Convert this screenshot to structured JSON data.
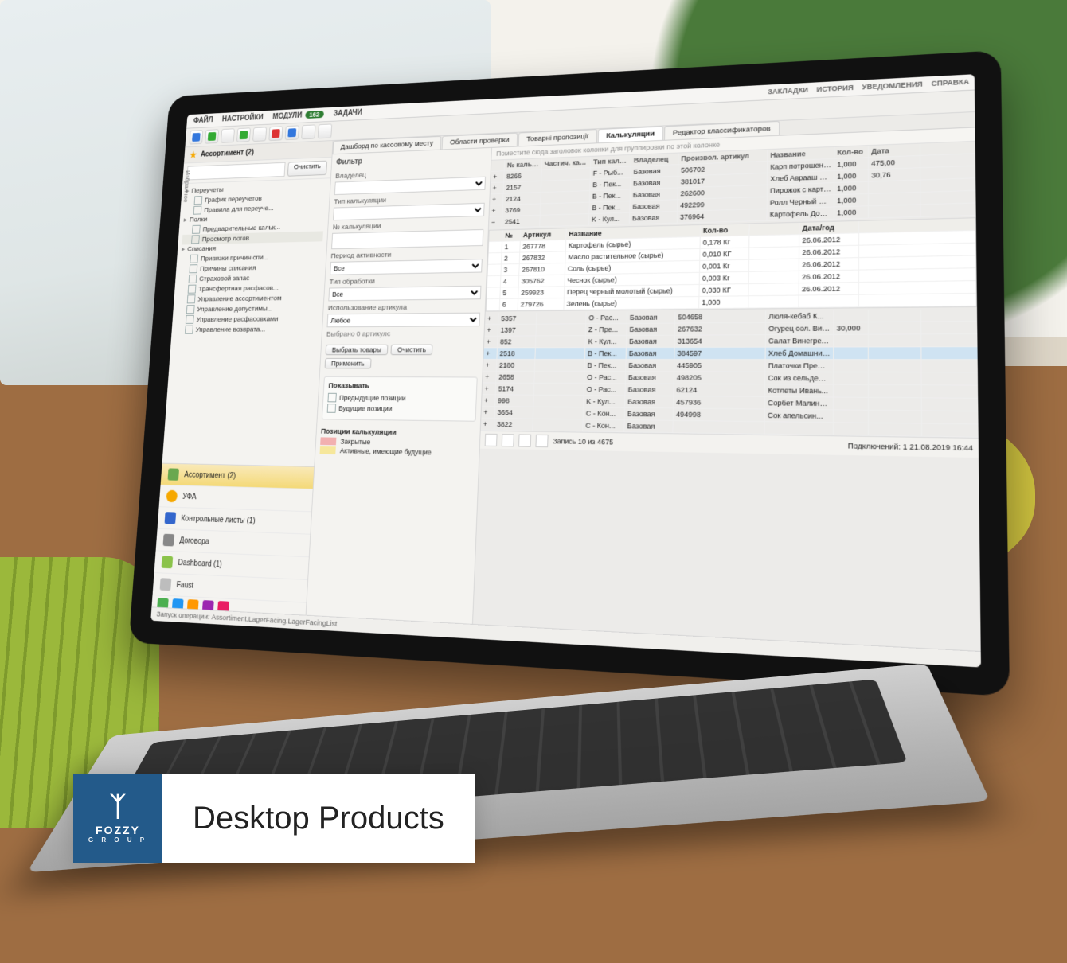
{
  "caption": {
    "brand": "FOZZY",
    "brand_sub": "G R O U P",
    "title": "Desktop Products"
  },
  "menu": {
    "items": [
      "ФАЙЛ",
      "НАСТРОЙКИ",
      "МОДУЛИ",
      "ЗАДАЧИ"
    ],
    "badge": "162",
    "right": [
      "ЗАКЛАДКИ",
      "ИСТОРИЯ",
      "УВЕДОМЛЕНИЯ",
      "СПРАВКА"
    ]
  },
  "sidebar": {
    "header": "Ассортимент (2)",
    "side_tab": "Избранное",
    "clear": "Очистить",
    "tree": [
      {
        "label": "Переучеты",
        "kind": "folder"
      },
      {
        "label": "График переучетов",
        "kind": "item"
      },
      {
        "label": "Правила для переуче...",
        "kind": "item"
      },
      {
        "label": "Полки",
        "kind": "folder"
      },
      {
        "label": "Предварительные кальк...",
        "kind": "item"
      },
      {
        "label": "Просмотр логов",
        "kind": "item",
        "sel": true
      },
      {
        "label": "Списания",
        "kind": "folder"
      },
      {
        "label": "Привязки причин спи...",
        "kind": "item"
      },
      {
        "label": "Причины списания",
        "kind": "item"
      },
      {
        "label": "Страховой запас",
        "kind": "item"
      },
      {
        "label": "Трансфертная расфасов...",
        "kind": "item"
      },
      {
        "label": "Управление ассортиментом",
        "kind": "item"
      },
      {
        "label": "Управление допустимы...",
        "kind": "item"
      },
      {
        "label": "Управление расфасовками",
        "kind": "item"
      },
      {
        "label": "Управление возврата...",
        "kind": "item"
      }
    ],
    "nav": [
      {
        "label": "Ассортимент (2)",
        "ic": "ic-ass",
        "active": true
      },
      {
        "label": "УФА",
        "ic": "ic-ufa"
      },
      {
        "label": "Контрольные листы (1)",
        "ic": "ic-kl"
      },
      {
        "label": "Договора",
        "ic": "ic-dog"
      },
      {
        "label": "Dashboard (1)",
        "ic": "ic-dash"
      },
      {
        "label": "Faust",
        "ic": "ic-faust"
      }
    ]
  },
  "tabs": [
    "Дашборд по кассовому месту",
    "Области проверки",
    "Товарні пропозиції",
    "Калькуляции",
    "Редактор классификаторов"
  ],
  "active_tab": 3,
  "filter": {
    "title": "Фильтр",
    "fields": {
      "owner": "Владелец",
      "type": "Тип калькуляции",
      "num": "№ калькуляции",
      "period": "Период активности",
      "proc": "Тип обработки",
      "use_art": "Использование артикула"
    },
    "period_val": "Все",
    "proc_val": "Все",
    "use_art_val": "Любое",
    "selected_info": "Выбрано 0 артикулс",
    "btn_select": "Выбрать товары",
    "btn_clear": "Очистить",
    "btn_apply": "Применить",
    "show_title": "Показывать",
    "chk_prev": "Предыдущие позиции",
    "chk_future": "Будущие позиции",
    "legend_title": "Позиции калькуляции",
    "legend_closed": "Закрытые",
    "legend_active": "Активные, имеющие будущие"
  },
  "grid": {
    "group_hint": "Поместите сюда заголовок колонки для группировки по этой колонке",
    "cols": [
      "",
      "№ калькул.",
      "Частич. калькул.",
      "Тип калькул.",
      "Владелец",
      "Произвол. артикул",
      "Название",
      "Кол-во",
      "Дата"
    ],
    "rows": [
      {
        "exp": "+",
        "num": "8266",
        "part": "",
        "type": "F - Рыб...",
        "owner": "Базовая",
        "art": "506702",
        "name": "Карп потрошеный ч...",
        "qty": "1,000",
        "date": "475,00"
      },
      {
        "exp": "+",
        "num": "2157",
        "part": "",
        "type": "B - Пек...",
        "owner": "Базовая",
        "art": "381017",
        "name": "Хлеб Аврааш Фітнес",
        "qty": "1,000",
        "date": "30,76"
      },
      {
        "exp": "+",
        "num": "2124",
        "part": "",
        "type": "B - Пек...",
        "owner": "Базовая",
        "art": "262600",
        "name": "Пирожок с картошкой...",
        "qty": "1,000",
        "date": ""
      },
      {
        "exp": "+",
        "num": "3769",
        "part": "",
        "type": "B - Пек...",
        "owner": "Базовая",
        "art": "492299",
        "name": "Ролл Черный Дракон",
        "qty": "1,000",
        "date": ""
      },
      {
        "exp": "−",
        "num": "2541",
        "part": "",
        "type": "K - Кул...",
        "owner": "Базовая",
        "art": "376964",
        "name": "Картофель Дольки фри",
        "qty": "1,000",
        "date": ""
      }
    ],
    "sub_cols": [
      "",
      "№",
      "Артикул",
      "Название",
      "Кол-во",
      "",
      "Дата/год"
    ],
    "sub_rows": [
      {
        "n": "1",
        "art": "267778",
        "name": "Картофель (сырье)",
        "qty": "0,178 Кг",
        "d": "26.06.2012"
      },
      {
        "n": "2",
        "art": "267832",
        "name": "Масло растительное (сырье)",
        "qty": "0,010 КГ",
        "d": "26.06.2012"
      },
      {
        "n": "3",
        "art": "267810",
        "name": "Соль (сырье)",
        "qty": "0,001 Кг",
        "d": "26.06.2012"
      },
      {
        "n": "4",
        "art": "305762",
        "name": "Чеснок (сырье)",
        "qty": "0,003 Кг",
        "d": "26.06.2012"
      },
      {
        "n": "5",
        "art": "259923",
        "name": "Перец черный молотый (сырье)",
        "qty": "0,030 КГ",
        "d": "26.06.2012"
      },
      {
        "n": "6",
        "art": "279726",
        "name": "Зелень (сырье)",
        "qty": "1,000",
        "d": ""
      }
    ],
    "rows2": [
      {
        "exp": "+",
        "num": "5357",
        "type": "O - Рас...",
        "owner": "Базовая",
        "art": "504658",
        "name": "Люля-кебаб К...",
        "qty": "",
        "date": ""
      },
      {
        "exp": "+",
        "num": "1397",
        "type": "Z - Пре...",
        "owner": "Базовая",
        "art": "267632",
        "name": "Огурец сол. Винегрет Укр...",
        "qty": "30,000",
        "date": ""
      },
      {
        "exp": "+",
        "num": "852",
        "type": "K - Кул...",
        "owner": "Базовая",
        "art": "313654",
        "name": "Салат Винегрет пр...",
        "qty": "",
        "date": ""
      },
      {
        "exp": "+",
        "num": "2518",
        "type": "B - Пек...",
        "owner": "Базовая",
        "art": "384597",
        "name": "Хлеб Домашний ВР чо...",
        "qty": "",
        "date": "",
        "hl": true
      },
      {
        "exp": "+",
        "num": "2180",
        "type": "B - Пек...",
        "owner": "Базовая",
        "art": "445905",
        "name": "Платочки Премиа с ку...",
        "qty": "",
        "date": ""
      },
      {
        "exp": "+",
        "num": "2658",
        "type": "O - Рас...",
        "owner": "Базовая",
        "art": "498205",
        "name": "Сок из сельдерея 200...",
        "qty": "",
        "date": ""
      },
      {
        "exp": "+",
        "num": "5174",
        "type": "O - Рас...",
        "owner": "Базовая",
        "art": "62124",
        "name": "Котлеты Ивань...",
        "qty": "",
        "date": ""
      },
      {
        "exp": "+",
        "num": "998",
        "type": "K - Кул...",
        "owner": "Базовая",
        "art": "457936",
        "name": "Сорбет Малиновый",
        "qty": "",
        "date": ""
      },
      {
        "exp": "+",
        "num": "3654",
        "type": "C - Кон...",
        "owner": "Базовая",
        "art": "494998",
        "name": "Сок апельсин...",
        "qty": "",
        "date": ""
      },
      {
        "exp": "+",
        "num": "3822",
        "type": "C - Кон...",
        "owner": "Базовая",
        "art": "",
        "name": "",
        "qty": "",
        "date": ""
      }
    ],
    "pager": "Запись 10 из 4675",
    "pager_right": "Подключений: 1   21.08.2019 16:44"
  },
  "status": "Запуск операции: Assortiment.LagerFacing.LagerFacingList"
}
